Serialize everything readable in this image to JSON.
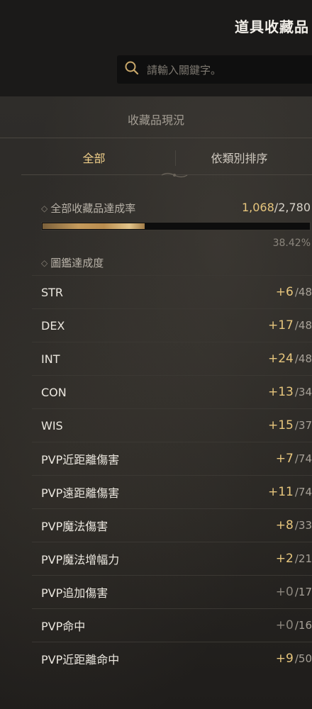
{
  "header": {
    "title": "道具收藏品"
  },
  "search": {
    "placeholder": "請輸入關鍵字。"
  },
  "panel": {
    "heading": "收藏品現況"
  },
  "tabs": [
    {
      "label": "全部",
      "active": true
    },
    {
      "label": "依類別排序",
      "active": false
    }
  ],
  "completion": {
    "label": "全部收藏品達成率",
    "current": "1,068",
    "total": "/2,780",
    "percent_text": "38.42%",
    "fraction": 0.3842
  },
  "codex": {
    "label": "圖鑑達成度"
  },
  "stats": [
    {
      "name": "STR",
      "bonus": "+6",
      "max": "/48"
    },
    {
      "name": "DEX",
      "bonus": "+17",
      "max": "/48"
    },
    {
      "name": "INT",
      "bonus": "+24",
      "max": "/48"
    },
    {
      "name": "CON",
      "bonus": "+13",
      "max": "/34"
    },
    {
      "name": "WIS",
      "bonus": "+15",
      "max": "/37"
    },
    {
      "name": "PVP近距離傷害",
      "bonus": "+7",
      "max": "/74"
    },
    {
      "name": "PVP遠距離傷害",
      "bonus": "+11",
      "max": "/74"
    },
    {
      "name": "PVP魔法傷害",
      "bonus": "+8",
      "max": "/33"
    },
    {
      "name": "PVP魔法增幅力",
      "bonus": "+2",
      "max": "/21"
    },
    {
      "name": "PVP追加傷害",
      "bonus": "+0",
      "max": "/17"
    },
    {
      "name": "PVP命中",
      "bonus": "+0",
      "max": "/16"
    },
    {
      "name": "PVP近距離命中",
      "bonus": "+9",
      "max": "/50"
    }
  ],
  "colors": {
    "accent": "#e7c67d",
    "muted": "#8a857c",
    "background": "#1b1a19"
  },
  "icons": {
    "search": "search-icon",
    "section_marker": "diamond-icon"
  }
}
